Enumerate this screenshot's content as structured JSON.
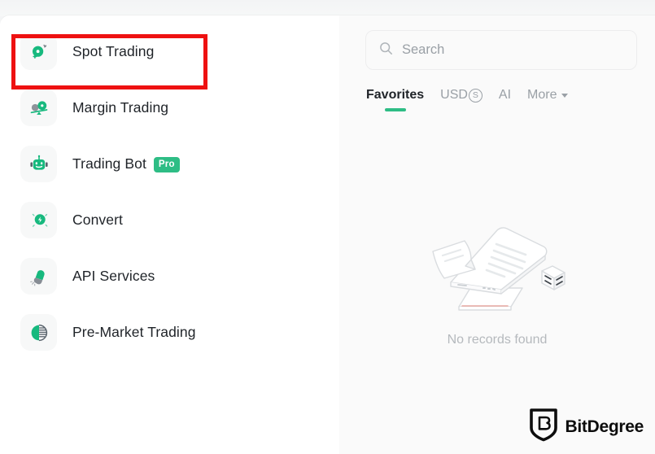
{
  "nav": {
    "items": [
      {
        "label": "Spot Trading",
        "icon": "spot-trading-icon",
        "badge": null,
        "highlighted": true
      },
      {
        "label": "Margin Trading",
        "icon": "margin-trading-icon",
        "badge": null,
        "highlighted": false
      },
      {
        "label": "Trading Bot",
        "icon": "trading-bot-icon",
        "badge": "Pro",
        "highlighted": false
      },
      {
        "label": "Convert",
        "icon": "convert-icon",
        "badge": null,
        "highlighted": false
      },
      {
        "label": "API Services",
        "icon": "api-services-icon",
        "badge": null,
        "highlighted": false
      },
      {
        "label": "Pre-Market Trading",
        "icon": "pre-market-trading-icon",
        "badge": null,
        "highlighted": false
      }
    ]
  },
  "search": {
    "placeholder": "Search",
    "value": "",
    "icon": "search-icon"
  },
  "tabs": {
    "items": [
      {
        "label": "Favorites",
        "active": true,
        "caret": false
      },
      {
        "label": "USD",
        "active": false,
        "caret": false,
        "suffix": "S"
      },
      {
        "label": "AI",
        "active": false,
        "caret": false
      },
      {
        "label": "More",
        "active": false,
        "caret": true
      }
    ]
  },
  "empty_state": {
    "text": "No records found",
    "illustration": "no-records-illustration"
  },
  "watermark": {
    "text": "BitDegree",
    "icon": "bitdegree-shield-icon"
  },
  "annotation": {
    "type": "red-highlight-rectangle",
    "target": "Spot Trading"
  },
  "colors": {
    "accent_green": "#2ebd85",
    "highlight_red": "#ee1111",
    "panel_white": "#ffffff",
    "list_background": "#fafafa",
    "muted_text": "#9aa0a6"
  }
}
